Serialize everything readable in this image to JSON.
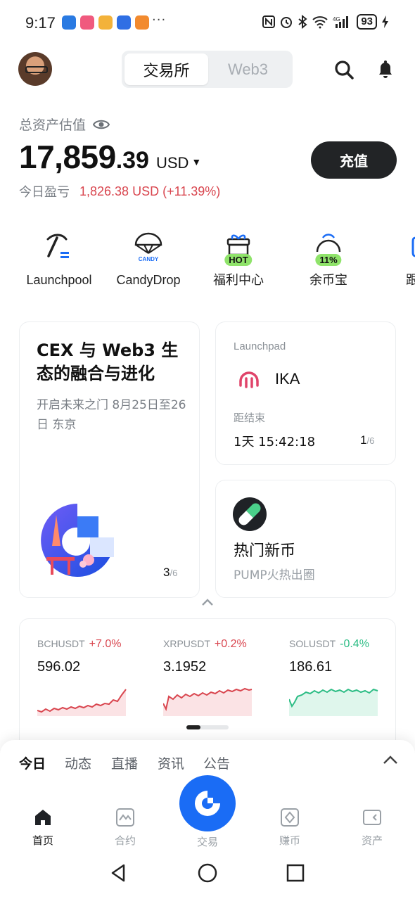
{
  "status_bar": {
    "time": "9:17",
    "more": "···",
    "battery": "93"
  },
  "header": {
    "tabs": [
      "交易所",
      "Web3"
    ],
    "active_tab": 0
  },
  "assets": {
    "label": "总资产估值",
    "value_int": "17,859",
    "value_dec": ".39",
    "currency": "USD",
    "pnl_label": "今日盈亏",
    "pnl_value": "1,826.38 USD (+11.39%)",
    "deposit_label": "充值"
  },
  "quick_entries": [
    {
      "label": "Launchpool",
      "icon": "pickaxe-icon"
    },
    {
      "label": "CandyDrop",
      "icon": "candy-parachute-icon",
      "icon_text": "CANDY"
    },
    {
      "label": "福利中心",
      "icon": "gift-icon",
      "badge": "HOT"
    },
    {
      "label": "余币宝",
      "icon": "savings-icon",
      "badge": "11%"
    },
    {
      "label": "跟",
      "icon": "copy-trade-icon"
    }
  ],
  "event_card": {
    "title": "CEX 与 Web3 生态的融合与进化",
    "subtitle": "开启未来之门 8月25日至26日 东京",
    "page": "3",
    "total": "/6"
  },
  "launchpad_card": {
    "label": "Launchpad",
    "coin": "IKA",
    "end_label": "距结束",
    "countdown": "1天 15:42:18",
    "page": "1",
    "total": "/6"
  },
  "hot_card": {
    "title": "热门新币",
    "subtitle": "PUMP火热出圈"
  },
  "tickers": [
    {
      "symbol": "BCHUSDT",
      "change": "+7.0%",
      "price": "596.02",
      "trend": "up"
    },
    {
      "symbol": "XRPUSDT",
      "change": "+0.2%",
      "price": "3.1952",
      "trend": "up"
    },
    {
      "symbol": "SOLUSDT",
      "change": "-0.4%",
      "price": "186.61",
      "trend": "down"
    }
  ],
  "feed_tabs": [
    "今日",
    "动态",
    "直播",
    "资讯",
    "公告"
  ],
  "bottom_nav": [
    {
      "label": "首页",
      "icon": "home-icon"
    },
    {
      "label": "合约",
      "icon": "futures-icon"
    },
    {
      "label": "交易",
      "icon": "trade-icon"
    },
    {
      "label": "赚币",
      "icon": "earn-icon"
    },
    {
      "label": "资产",
      "icon": "wallet-icon"
    }
  ],
  "colors": {
    "accent": "#1a6cf5",
    "up": "#d9464f",
    "down": "#2dbd85",
    "badge": "#8fe36a"
  }
}
